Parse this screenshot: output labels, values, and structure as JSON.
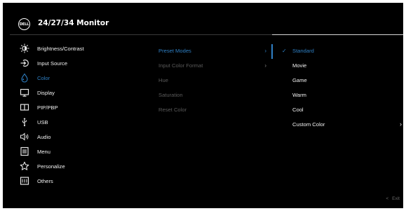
{
  "header": {
    "logo_text": "DELL",
    "title": "24/27/34 Monitor"
  },
  "main_menu": [
    {
      "label": "Brightness/Contrast",
      "icon": "brightness-icon",
      "active": false
    },
    {
      "label": "Input Source",
      "icon": "input-source-icon",
      "active": false
    },
    {
      "label": "Color",
      "icon": "color-icon",
      "active": true
    },
    {
      "label": "Display",
      "icon": "display-icon",
      "active": false
    },
    {
      "label": "PIP/PBP",
      "icon": "pip-icon",
      "active": false
    },
    {
      "label": "USB",
      "icon": "usb-icon",
      "active": false
    },
    {
      "label": "Audio",
      "icon": "audio-icon",
      "active": false
    },
    {
      "label": "Menu",
      "icon": "menu-icon",
      "active": false
    },
    {
      "label": "Personalize",
      "icon": "star-icon",
      "active": false
    },
    {
      "label": "Others",
      "icon": "others-icon",
      "active": false
    }
  ],
  "color_submenu": [
    {
      "label": "Preset Modes",
      "has_arrow": true,
      "active": true
    },
    {
      "label": "Input Color Format",
      "has_arrow": true,
      "active": false
    },
    {
      "label": "Hue",
      "has_arrow": false,
      "active": false
    },
    {
      "label": "Saturation",
      "has_arrow": false,
      "active": false
    },
    {
      "label": "Reset Color",
      "has_arrow": false,
      "active": false
    }
  ],
  "preset_options": [
    {
      "label": "Standard",
      "selected": true
    },
    {
      "label": "Movie",
      "selected": false
    },
    {
      "label": "Game",
      "selected": false
    },
    {
      "label": "Warm",
      "selected": false
    },
    {
      "label": "Cool",
      "selected": false
    },
    {
      "label": "Custom Color",
      "selected": false,
      "has_arrow": true
    }
  ],
  "footer": {
    "exit_label": "Exit"
  },
  "colors": {
    "accent": "#2e7fc3",
    "background": "#000000",
    "text": "#f2f2f2",
    "dim_text": "#5a5a5a"
  }
}
